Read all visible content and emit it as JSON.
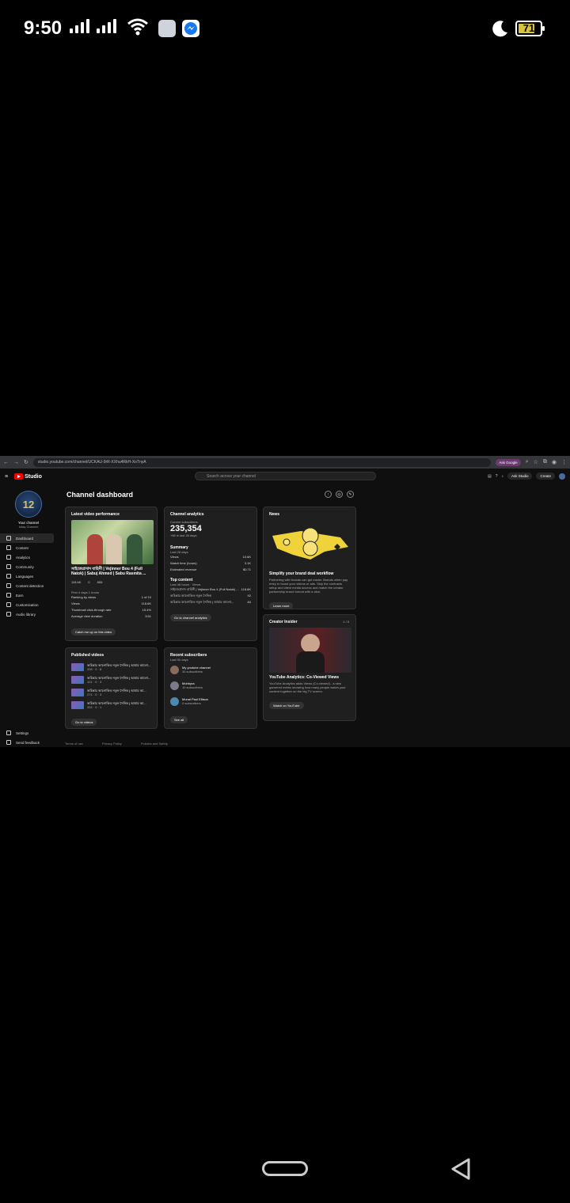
{
  "status_bar": {
    "time": "9:50",
    "battery": "71"
  },
  "browser": {
    "url": "studio.youtube.com/channel/UCKAU-9rR-XXhu4RkH-XoTnyA",
    "ask_google": "Ask Google"
  },
  "studio": {
    "logo": "Studio",
    "search_placeholder": "Search across your channel",
    "ask_studio": "Ask Studio",
    "create": "Create"
  },
  "sidebar": {
    "channel_title": "Your channel",
    "channel_sub": "Isfaq Channel",
    "avatar_text": "12",
    "items": [
      {
        "label": "Dashboard"
      },
      {
        "label": "Content"
      },
      {
        "label": "Analytics"
      },
      {
        "label": "Community"
      },
      {
        "label": "Languages"
      },
      {
        "label": "Content detection"
      },
      {
        "label": "Earn"
      },
      {
        "label": "Customisation"
      },
      {
        "label": "Audio library"
      }
    ],
    "settings": "Settings",
    "feedback": "Send feedback"
  },
  "dashboard": {
    "title": "Channel dashboard",
    "latest": {
      "heading": "Latest video performance",
      "video_title": "সাইজেপ্রসাদ বাহিনী | Vejinner Bou 4 (Full Natok) | Sabuj Ahmed | Sabu Rasmita ...",
      "views_stat": "118.6K",
      "comments_stat": "0",
      "likes_stat": "855",
      "period": "First 4 days 1 hours",
      "rows": [
        {
          "label": "Ranking by views",
          "value": "1 of 10"
        },
        {
          "label": "Views",
          "value": "118.6K"
        },
        {
          "label": "Thumbnail click-through rate",
          "value": "15.4%"
        },
        {
          "label": "Average view duration",
          "value": "3:51"
        }
      ],
      "catch_up": "Catch me up on this video"
    },
    "analytics": {
      "heading": "Channel analytics",
      "subs_label": "Current subscribers",
      "subs_value": "235,354",
      "subs_change": "+66 in last 28 days",
      "summary_label": "Summary",
      "summary_period": "Last 28 days",
      "rows": [
        {
          "label": "Views",
          "value": "10.6K"
        },
        {
          "label": "Watch time (hours)",
          "value": "3.1K"
        },
        {
          "label": "Estimated revenue",
          "value": "$0.71"
        }
      ],
      "top_label": "Top content",
      "top_period": "Last 48 hours · Views",
      "top_rows": [
        {
          "label": "সাইজেপ্রসাদ বাহিনী | Vejinner Bou 4 (Full Natok) ...",
          "value": "118.6K"
        },
        {
          "label": "অচিন্তার আলোকিত নতুন সৈনিক",
          "value": "92"
        },
        {
          "label": "অচিন্তার আলোকিত নতুন সৈনিক | আমার আলো...",
          "value": "84"
        }
      ],
      "go_analytics": "Go to channel analytics"
    },
    "news": {
      "heading": "News",
      "title": "Simplify your brand deal workflow",
      "body": "Partnering with brands can get easier. Brands when pay entry to boost your videos or ads. Skip the contracts setup and client media access and match the creator partnership brand format with a click.",
      "button": "Learn more"
    },
    "published": {
      "heading": "Published videos",
      "items": [
        {
          "title": "অচিন্তার আলোকিত নতুন সৈনিক | আমার আলো...",
          "stats": "339 · 0 · 8"
        },
        {
          "title": "অচিন্তার আলোকিত নতুন সৈনিক | আমার আলো...",
          "stats": "101 · 0 · 3"
        },
        {
          "title": "অচিন্তার আলোকিত নতুন সৈনিক | আমার আ...",
          "stats": "271 · 0 · 3"
        },
        {
          "title": "অচিন্তার আলোকিত নতুন সৈনিক | আমার আ...",
          "stats": "332 · 0 · 1"
        }
      ],
      "button": "Go to videos"
    },
    "subscribers": {
      "heading": "Recent subscribers",
      "period": "Last 90 days",
      "items": [
        {
          "name": "My youtube channel",
          "subs": "30 subscribers",
          "color": "#8a6a5a"
        },
        {
          "name": "Mohbyra",
          "subs": "10 subscribers",
          "color": "#7a7a8a"
        },
        {
          "name": "Monal Paul Ellison",
          "subs": "0 subscribers",
          "color": "#4a8ab0"
        }
      ],
      "button": "See all"
    },
    "insider": {
      "heading": "Creator Insider",
      "pager": "1 / 5",
      "title": "YouTube Analytics: Co-Viewed Views",
      "body": "YouTube Analytics adds Views (Co-viewed) - a new garnered metric showing how many people watch your content together on the big TV screen.",
      "button": "Watch on YouTube"
    },
    "footer": [
      "Terms of use",
      "Privacy Policy",
      "Policies and Safety"
    ]
  }
}
